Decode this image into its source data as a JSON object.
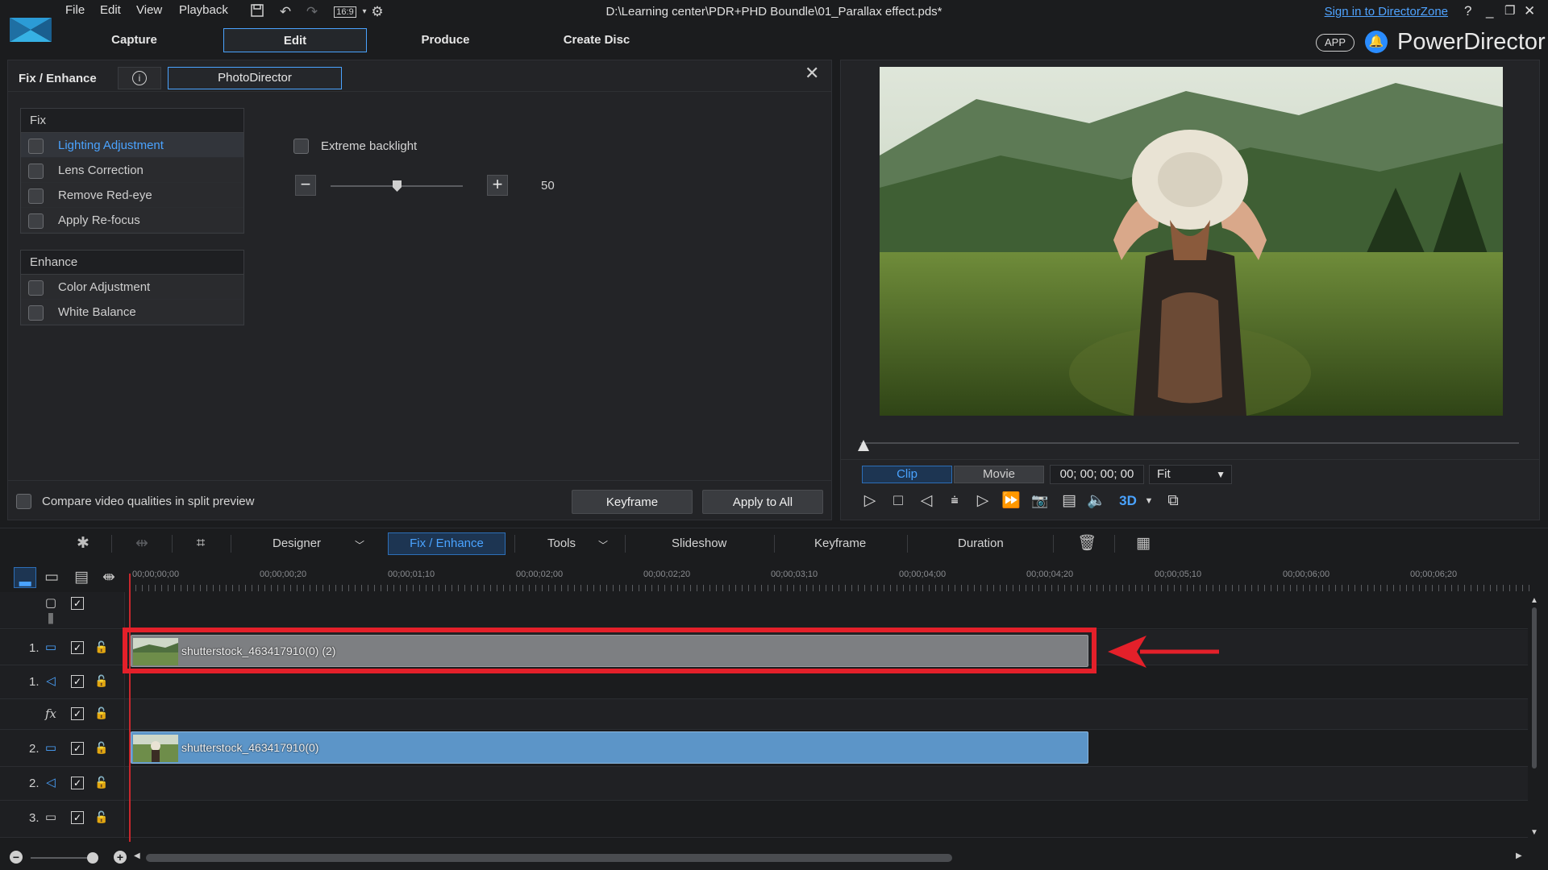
{
  "menu": {
    "file": "File",
    "edit": "Edit",
    "view": "View",
    "playback": "Playback",
    "aspect": "16:9"
  },
  "window": {
    "title": "D:\\Learning center\\PDR+PHD Boundle\\01_Parallax effect.pds*",
    "signin": "Sign in to DirectorZone",
    "help": "?",
    "minimize": "_",
    "restore": "❐",
    "close": "✕"
  },
  "tabs": {
    "capture": "Capture",
    "edit": "Edit",
    "produce": "Produce",
    "create_disc": "Create Disc"
  },
  "brand": {
    "app_badge": "APP",
    "name": "PowerDirector"
  },
  "fix_panel": {
    "title": "Fix / Enhance",
    "photodirector": "PhotoDirector",
    "fix_header": "Fix",
    "fix_items": [
      "Lighting Adjustment",
      "Lens Correction",
      "Remove Red-eye",
      "Apply Re-focus"
    ],
    "enhance_header": "Enhance",
    "enhance_items": [
      "Color Adjustment",
      "White Balance"
    ],
    "extreme_backlight": "Extreme backlight",
    "slider_value": "50",
    "compare_label": "Compare video qualities in split preview",
    "keyframe_btn": "Keyframe",
    "apply_all_btn": "Apply to All"
  },
  "preview": {
    "clip": "Clip",
    "movie": "Movie",
    "timecode": "00; 00; 00; 00",
    "fit": "Fit",
    "scrub_position": 0
  },
  "toolbar": {
    "designer": "Designer",
    "fix_enhance": "Fix / Enhance",
    "tools": "Tools",
    "slideshow": "Slideshow",
    "keyframe": "Keyframe",
    "duration": "Duration"
  },
  "ruler": {
    "ticks": [
      "00;00;00;00",
      "00;00;00;20",
      "00;00;01;10",
      "00;00;02;00",
      "00;00;02;20",
      "00;00;03;10",
      "00;00;04;00",
      "00;00;04;20",
      "00;00;05;10",
      "00;00;06;00",
      "00;00;06;20"
    ]
  },
  "tracks": [
    {
      "num": "1.",
      "type": "video",
      "clip": "shutterstock_463417910(0) (2)"
    },
    {
      "num": "1.",
      "type": "audio"
    },
    {
      "num": "",
      "type": "fx"
    },
    {
      "num": "2.",
      "type": "video",
      "clip": "shutterstock_463417910(0)"
    },
    {
      "num": "2.",
      "type": "audio"
    },
    {
      "num": "3.",
      "type": "video"
    }
  ],
  "colors": {
    "accent": "#4aa3ff",
    "highlight": "#e4202a",
    "clip_grey": "#7d7f82",
    "clip_blue": "#5c95c8"
  }
}
